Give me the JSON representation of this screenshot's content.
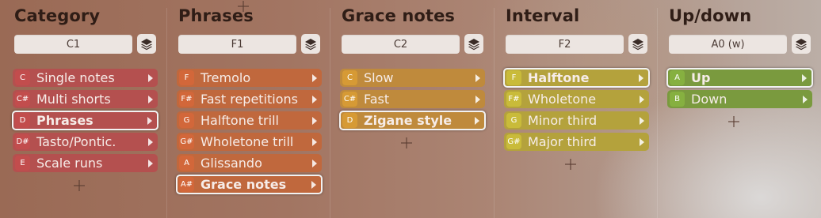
{
  "columns": [
    {
      "title": "Category",
      "key": "C1",
      "icon": "layers-icon",
      "row_color": "#b4504f",
      "note_color": "#c24d4d",
      "items": [
        {
          "note": "C",
          "label": "Single notes",
          "selected": false
        },
        {
          "note": "C#",
          "label": "Multi shorts",
          "selected": false
        },
        {
          "note": "D",
          "label": "Phrases",
          "selected": true
        },
        {
          "note": "D#",
          "label": "Tasto/Pontic.",
          "selected": false
        },
        {
          "note": "E",
          "label": "Scale runs",
          "selected": false
        }
      ]
    },
    {
      "title": "Phrases",
      "key": "F1",
      "icon": "layers-icon",
      "row_color": "#c0683d",
      "note_color": "#d2673a",
      "items": [
        {
          "note": "F",
          "label": "Tremolo",
          "selected": false
        },
        {
          "note": "F#",
          "label": "Fast repetitions",
          "selected": false
        },
        {
          "note": "G",
          "label": "Halftone trill",
          "selected": false
        },
        {
          "note": "G#",
          "label": "Wholetone trill",
          "selected": false
        },
        {
          "note": "A",
          "label": "Glissando",
          "selected": false
        },
        {
          "note": "A#",
          "label": "Grace notes",
          "selected": true
        }
      ]
    },
    {
      "title": "Grace notes",
      "key": "C2",
      "icon": "layers-icon",
      "row_color": "#bf8a3c",
      "note_color": "#d69a35",
      "items": [
        {
          "note": "C",
          "label": "Slow",
          "selected": false
        },
        {
          "note": "C#",
          "label": "Fast",
          "selected": false
        },
        {
          "note": "D",
          "label": "Zigane style",
          "selected": true
        }
      ]
    },
    {
      "title": "Interval",
      "key": "F2",
      "icon": "layers-icon",
      "row_color": "#b4a23c",
      "note_color": "#c9bb3a",
      "items": [
        {
          "note": "F",
          "label": "Halftone",
          "selected": true
        },
        {
          "note": "F#",
          "label": "Wholetone",
          "selected": false
        },
        {
          "note": "G",
          "label": "Minor third",
          "selected": false
        },
        {
          "note": "G#",
          "label": "Major third",
          "selected": false
        }
      ]
    },
    {
      "title": "Up/down",
      "key": "A0 (w)",
      "icon": "layers-icon",
      "row_color": "#7a9a3e",
      "note_color": "#86b040",
      "items": [
        {
          "note": "A",
          "label": "Up",
          "selected": true
        },
        {
          "note": "B",
          "label": "Down",
          "selected": false
        }
      ]
    }
  ],
  "add_icon": "plus-icon"
}
